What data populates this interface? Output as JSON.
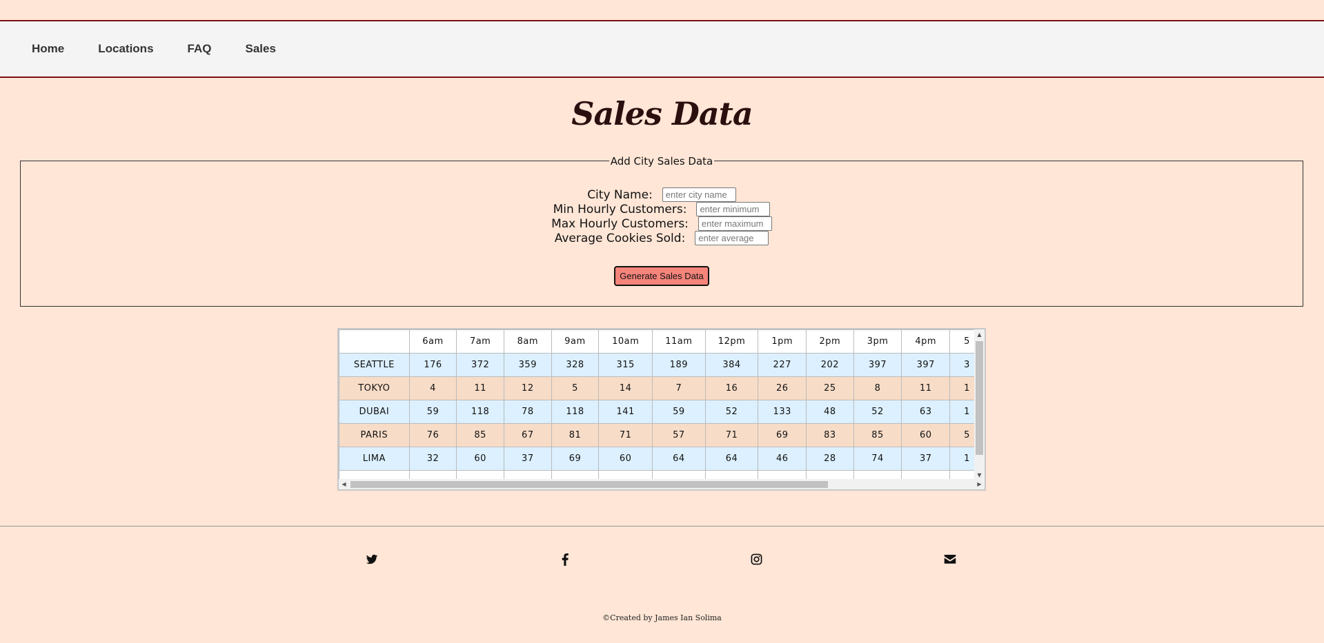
{
  "nav": {
    "items": [
      {
        "label": "Home"
      },
      {
        "label": "Locations"
      },
      {
        "label": "FAQ"
      },
      {
        "label": "Sales"
      }
    ]
  },
  "page": {
    "title": "Sales Data"
  },
  "form": {
    "legend": "Add City Sales Data",
    "fields": [
      {
        "label": "City Name:",
        "placeholder": "enter city name"
      },
      {
        "label": "Min Hourly Customers:",
        "placeholder": "enter minimum"
      },
      {
        "label": "Max Hourly Customers:",
        "placeholder": "enter maximum"
      },
      {
        "label": "Average Cookies Sold:",
        "placeholder": "enter average"
      }
    ],
    "submit_label": "Generate Sales Data",
    "colors": {
      "button": "#f5847b"
    }
  },
  "table": {
    "headers": [
      "6am",
      "7am",
      "8am",
      "9am",
      "10am",
      "11am",
      "12pm",
      "1pm",
      "2pm",
      "3pm",
      "4pm",
      "5"
    ],
    "rows": [
      {
        "city": "SEATTLE",
        "values": [
          "176",
          "372",
          "359",
          "328",
          "315",
          "189",
          "384",
          "227",
          "202",
          "397",
          "397",
          "3"
        ]
      },
      {
        "city": "TOKYO",
        "values": [
          "4",
          "11",
          "12",
          "5",
          "14",
          "7",
          "16",
          "26",
          "25",
          "8",
          "11",
          "1"
        ]
      },
      {
        "city": "DUBAI",
        "values": [
          "59",
          "118",
          "78",
          "118",
          "141",
          "59",
          "52",
          "133",
          "48",
          "52",
          "63",
          "1"
        ]
      },
      {
        "city": "PARIS",
        "values": [
          "76",
          "85",
          "67",
          "81",
          "71",
          "57",
          "71",
          "69",
          "83",
          "85",
          "60",
          "5"
        ]
      },
      {
        "city": "LIMA",
        "values": [
          "32",
          "60",
          "37",
          "69",
          "60",
          "64",
          "64",
          "46",
          "28",
          "74",
          "37",
          "1"
        ]
      }
    ],
    "colors": {
      "row_blue": "#dcf0ff",
      "row_tan": "#f7dcc7"
    }
  },
  "footer": {
    "social": [
      {
        "icon": "twitter-icon"
      },
      {
        "icon": "facebook-icon"
      },
      {
        "icon": "instagram-icon"
      },
      {
        "icon": "email-icon"
      }
    ],
    "copyright": "©Created by James Ian Solima"
  }
}
